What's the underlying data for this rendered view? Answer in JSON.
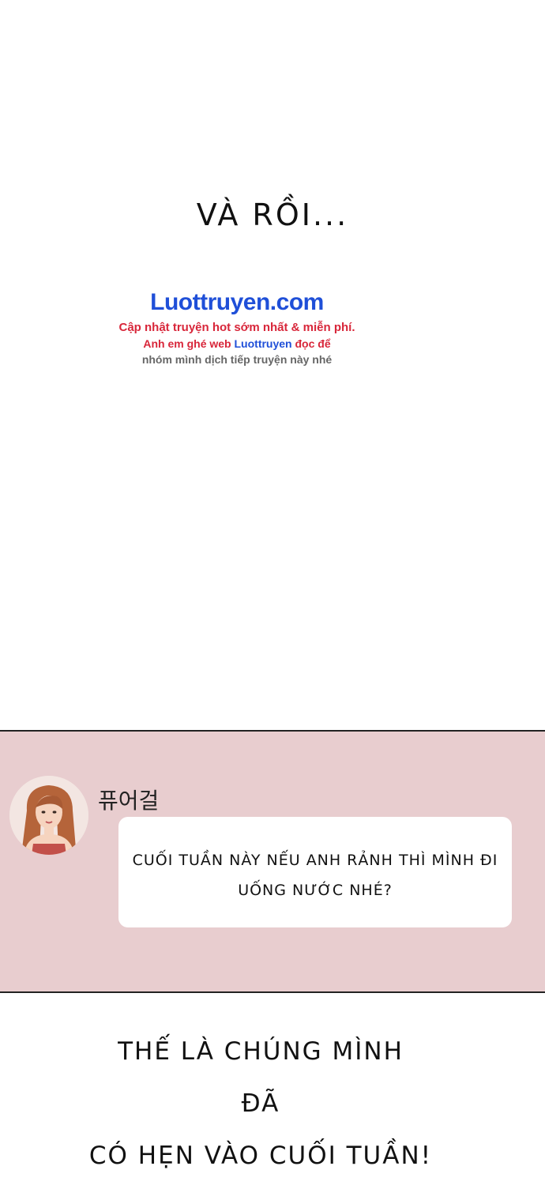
{
  "caption_top": "VÀ RỒI...",
  "watermark": {
    "brand": "Luottruyen.com",
    "line1": "Cập nhật truyện hot sớm nhất & miễn phí.",
    "line2_prefix": "Anh em ghé web ",
    "line2_brand": "Luottruyen",
    "line2_suffix": " đọc để",
    "line3": "nhóm mình dịch tiếp truyện này nhé",
    "colors": {
      "brand": "#1f4fd8",
      "red": "#d8263a",
      "gray": "#666666"
    }
  },
  "chat": {
    "background": "#e8cdcf",
    "avatar_icon": "woman-avatar-icon",
    "sender": "퓨어걸",
    "message_line1": "CUỐI TUẦN NÀY NẾU ANH RẢNH THÌ MÌNH ĐI",
    "message_line2": "UỐNG NƯỚC NHÉ?"
  },
  "caption_bottom": {
    "line1": "THẾ LÀ CHÚNG MÌNH",
    "line2": "ĐÃ",
    "line3": "CÓ HẸN VÀO CUỐI TUẦN!"
  }
}
